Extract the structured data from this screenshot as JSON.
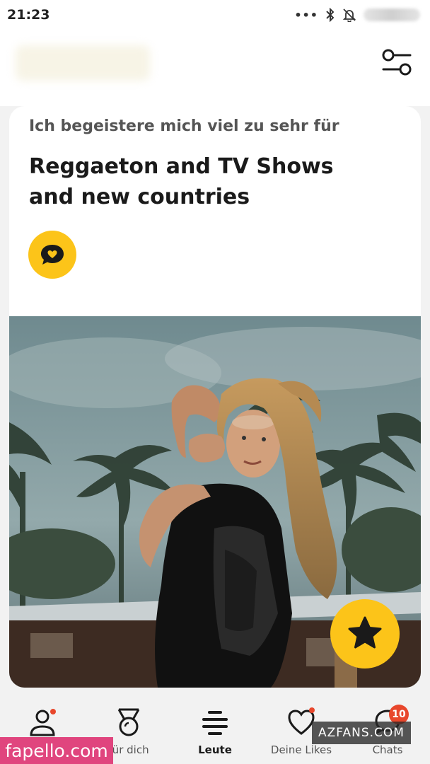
{
  "status_bar": {
    "time": "21:23",
    "icons": [
      "more-dots-icon",
      "bluetooth-icon",
      "notifications-off-icon"
    ]
  },
  "header": {
    "filter_icon": "filter-sliders-icon"
  },
  "card": {
    "subtitle": "Ich begeistere mich viel zu sehr für",
    "title": "Reggaeton and TV Shows and new countries",
    "comment_icon": "chat-heart-icon",
    "star_icon": "star-icon",
    "photo_subject": "profile-photo"
  },
  "bottom_nav": {
    "items": [
      {
        "label": "",
        "icon": "profile-icon"
      },
      {
        "label": "für dich",
        "icon": "medal-icon"
      },
      {
        "label": "Leute",
        "icon": "stack-icon",
        "active": true
      },
      {
        "label": "Deine Likes",
        "icon": "heart-icon"
      },
      {
        "label": "Chats",
        "icon": "chat-icon",
        "badge": "10"
      }
    ]
  },
  "watermarks": {
    "left": "fapello.com",
    "right": "AZFANS.COM"
  },
  "colors": {
    "accent": "#fcc419",
    "badge": "#e8472c",
    "dot": "#e8472c",
    "background": "#f2f2f2"
  }
}
